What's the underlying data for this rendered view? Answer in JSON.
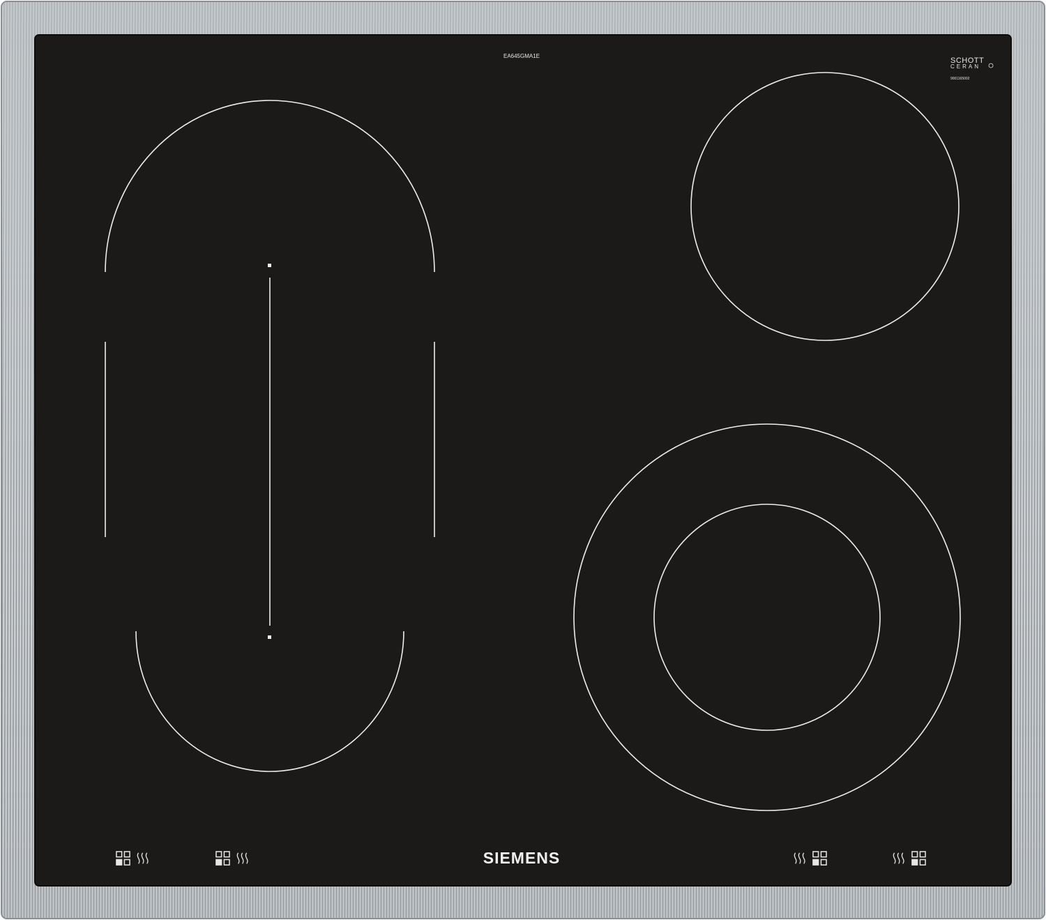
{
  "hob": {
    "model": "EA645GMA1E",
    "brand": "SIEMENS",
    "glass_brand_line1": "SCHOTT",
    "glass_brand_line2": "CERAN",
    "glass_code": "9001165002",
    "frame_material": "stainless steel",
    "glass_color": "#1c1a18"
  },
  "zones": [
    {
      "name": "left-oval-zone",
      "shape": "oval, split top/bottom"
    },
    {
      "name": "rear-right-zone",
      "shape": "circle"
    },
    {
      "name": "front-right-zone",
      "shape": "dual concentric circle"
    }
  ],
  "controls": [
    {
      "name": "control-front-left",
      "icons": [
        "zone-grid-icon",
        "heat-icon"
      ]
    },
    {
      "name": "control-rear-left",
      "icons": [
        "zone-grid-icon",
        "heat-icon"
      ]
    },
    {
      "name": "control-rear-right",
      "icons": [
        "heat-icon",
        "zone-grid-icon"
      ]
    },
    {
      "name": "control-front-right",
      "icons": [
        "heat-icon",
        "zone-grid-icon"
      ]
    }
  ]
}
